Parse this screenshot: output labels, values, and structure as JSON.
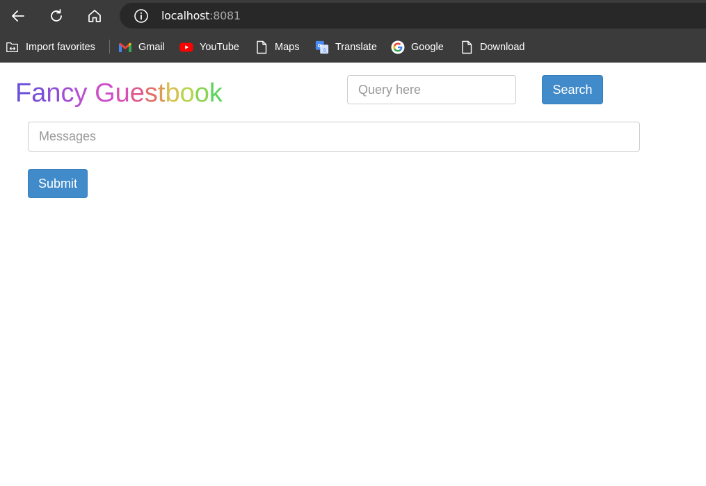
{
  "browser": {
    "url_host": "localhost",
    "url_port": ":8081",
    "bookmarks": [
      {
        "label": "Import favorites",
        "icon": "import-folder-icon"
      },
      {
        "label": "Gmail",
        "icon": "gmail-icon"
      },
      {
        "label": "YouTube",
        "icon": "youtube-icon"
      },
      {
        "label": "Maps",
        "icon": "file-icon"
      },
      {
        "label": "Translate",
        "icon": "translate-icon"
      },
      {
        "label": "Google",
        "icon": "google-icon"
      },
      {
        "label": "Download",
        "icon": "file-icon"
      }
    ]
  },
  "header": {
    "title_letters": [
      "F",
      "a",
      "n",
      "c",
      "y",
      " ",
      "G",
      "u",
      "e",
      "s",
      "t",
      "b",
      "o",
      "o",
      "k"
    ],
    "title_colors": [
      "#6a4fd8",
      "#7a4fd6",
      "#8e4fd4",
      "#a24fd2",
      "#b84fd0",
      "#b84fd0",
      "#cc4fc8",
      "#d84fb6",
      "#de5a8c",
      "#e0706a",
      "#dc9a52",
      "#d6c04e",
      "#b6d44e",
      "#8ad454",
      "#5cd45c"
    ],
    "search": {
      "placeholder": "Query here",
      "button_label": "Search"
    }
  },
  "form": {
    "messages_placeholder": "Messages",
    "submit_label": "Submit"
  },
  "colors": {
    "primary": "#428bca",
    "chrome": "#3b3b3b",
    "addressbar": "#282828"
  }
}
